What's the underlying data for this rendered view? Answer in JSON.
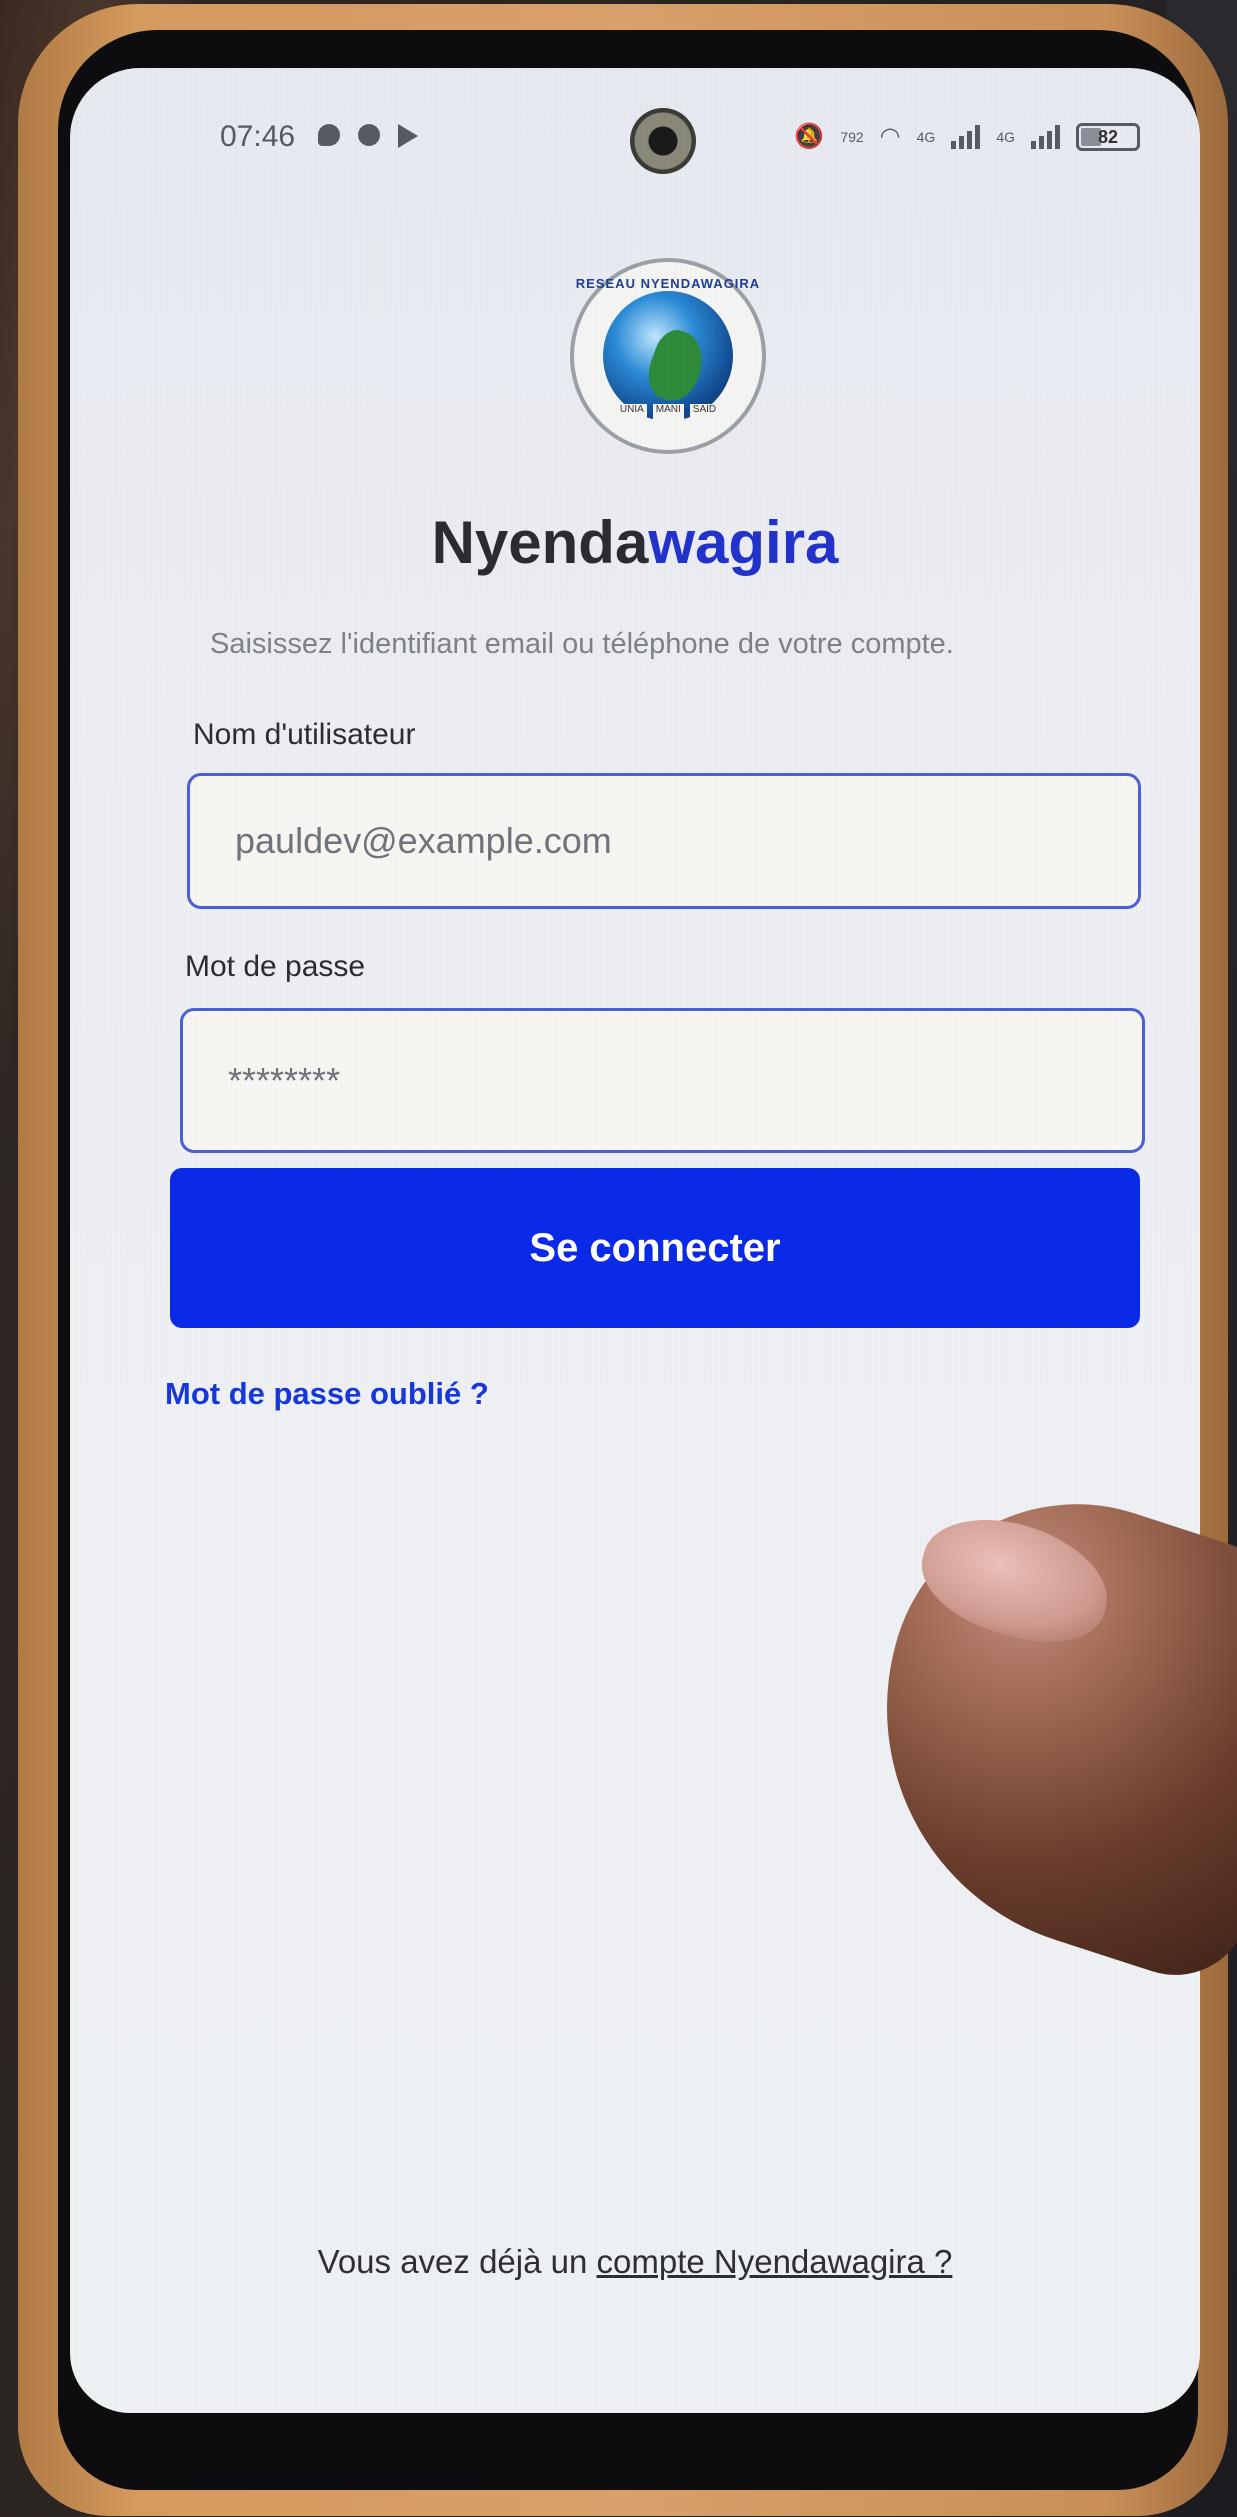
{
  "status_bar": {
    "time": "07:46",
    "data_speed": "792",
    "network_left": "4G",
    "network_right": "4G",
    "battery": "82",
    "icons": [
      "chat-icon",
      "gear-icon",
      "play-icon",
      "mute-icon",
      "wifi-icon",
      "signal-icon",
      "battery-icon"
    ]
  },
  "logo": {
    "ring_text": "RESEAU NYENDAWAGIRA",
    "banner": [
      "UNIA",
      "MANI",
      "SAID"
    ]
  },
  "brand": {
    "part1": "Nyenda",
    "part2": "wagira"
  },
  "subtitle": "Saisissez l'identifiant email ou téléphone de votre compte.",
  "username": {
    "label": "Nom d'utilisateur",
    "value": "pauldev@example.com"
  },
  "password": {
    "label": "Mot de passe",
    "value": "********"
  },
  "login_button": "Se connecter",
  "forgot_link": "Mot de passe oublié ?",
  "footer": {
    "prefix": "Vous avez déjà un ",
    "link": "compte Nyendawagira ?"
  },
  "colors": {
    "primary": "#0A2AE8",
    "brand_dark": "#2A2C33",
    "brand_blue": "#2233CC",
    "link": "#1638D9",
    "input_border": "#4C5FD4"
  }
}
